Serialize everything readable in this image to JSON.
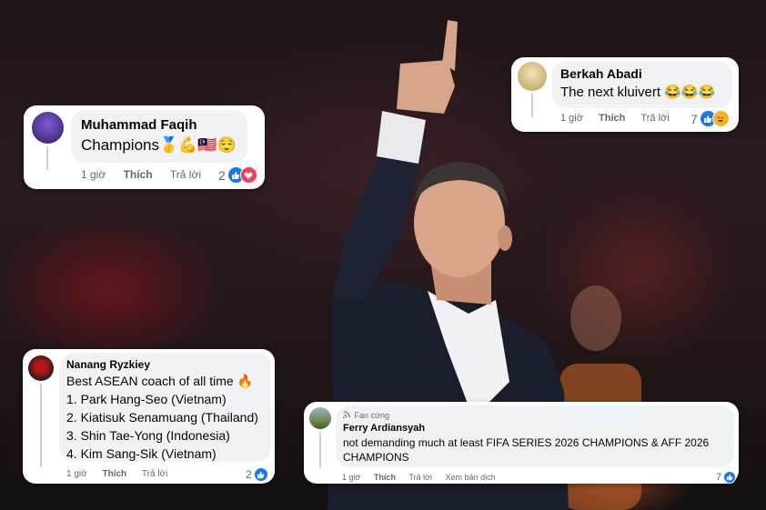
{
  "comments": [
    {
      "name": "Muhammad Faqih",
      "text": "Champions🥇💪🇲🇾😌",
      "time": "1 giờ",
      "like_label": "Thích",
      "reply_label": "Trả lời",
      "reaction_count": "2",
      "reactions": [
        "like-icon",
        "love-icon"
      ]
    },
    {
      "name": "Berkah Abadi",
      "text": "The next kluivert 😂😂😂",
      "time": "1 giờ",
      "like_label": "Thích",
      "reply_label": "Trả lời",
      "reaction_count": "7",
      "reactions": [
        "like-icon",
        "haha-icon"
      ]
    },
    {
      "name": "Nanang Ryzkiey",
      "lines": [
        "Best ASEAN coach of all time 🔥",
        "1. Park Hang-Seo (Vietnam)",
        "2. Kiatisuk Senamuang (Thailand)",
        "3. Shin Tae-Yong (Indonesia)",
        "4. Kim Sang-Sik (Vietnam)"
      ],
      "time": "1 giờ",
      "like_label": "Thích",
      "reply_label": "Trả lời",
      "reaction_count": "2",
      "reactions": [
        "like-icon"
      ]
    },
    {
      "badge": "Fan cứng",
      "name": "Ferry Ardiansyah",
      "lines": [
        "not demanding much at least FIFA SERIES 2026 CHAMPIONS & AFF 2026",
        "CHAMPIONS"
      ],
      "time": "1 giờ",
      "like_label": "Thích",
      "reply_label": "Trả lời",
      "translate_label": "Xem bản dịch",
      "reaction_count": "7",
      "reactions": [
        "like-icon"
      ]
    }
  ],
  "colors": {
    "like": "#1877f2",
    "love": "#f33e58",
    "haha": "#f7b125",
    "bubble": "#f0f2f5",
    "meta": "#65676b"
  }
}
